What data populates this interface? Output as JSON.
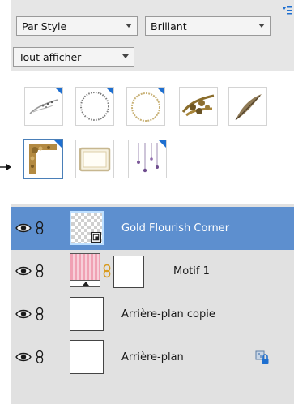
{
  "graphics_panel": {
    "filter_by_dropdown": "Par Style",
    "style_dropdown": "Brillant",
    "show_dropdown": "Tout afficher",
    "thumbnails": [
      {
        "icon": "feather-swirl-graphic",
        "selected": false
      },
      {
        "icon": "beaded-circle-frame-graphic",
        "selected": false
      },
      {
        "icon": "gold-circle-frame-graphic",
        "selected": false
      },
      {
        "icon": "gold-flourish-branch-graphic",
        "selected": false
      },
      {
        "icon": "feather-quill-graphic",
        "selected": false
      },
      {
        "icon": "gold-flourish-corner-graphic",
        "selected": true
      },
      {
        "icon": "ornate-rectangle-frame-graphic",
        "selected": false
      },
      {
        "icon": "hanging-ornaments-graphic",
        "selected": false
      }
    ]
  },
  "layers": [
    {
      "name": "Gold Flourish Corner",
      "selected": true,
      "thumb": "transparent-smart-object"
    },
    {
      "name": "Motif 1",
      "selected": false,
      "thumb": "pink-pattern-with-mask"
    },
    {
      "name": "Arrière-plan copie",
      "selected": false,
      "thumb": "white"
    },
    {
      "name": "Arrière-plan",
      "selected": false,
      "thumb": "white",
      "locked": true
    }
  ],
  "colors": {
    "selection": "#5d8fcf",
    "corner_badge": "#1e6fd0",
    "link_chain_gold": "#d89b1f"
  }
}
